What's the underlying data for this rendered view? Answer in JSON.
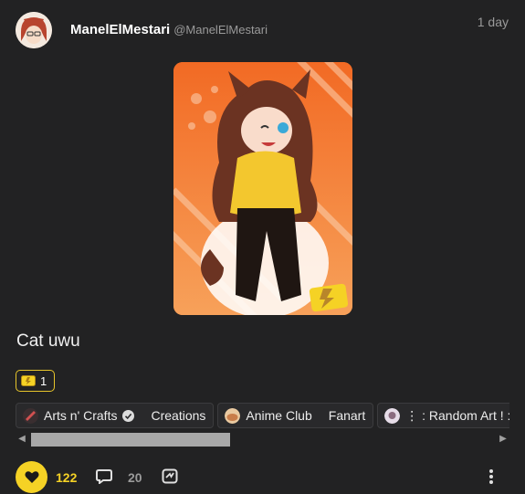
{
  "post": {
    "author_name": "ManelElMestari",
    "author_handle": "@ManelElMestari",
    "timestamp": "1 day",
    "title": "Cat uwu"
  },
  "badge": {
    "icon": "ticket-icon",
    "count": "1"
  },
  "chips": [
    {
      "community": "Arts n' Crafts",
      "verified": true,
      "category": "Creations"
    },
    {
      "community": "Anime Club",
      "category": "Fanart"
    },
    {
      "community": "⋮ : Random Art ! : .∙∿·"
    }
  ],
  "scrollbar": {
    "left_arrow": "◀",
    "right_arrow": "▶"
  },
  "actions": {
    "likes": "122",
    "comments": "20"
  },
  "colors": {
    "accent": "#f5d225",
    "background": "#222223",
    "artwork_bg": "#f07a2a"
  }
}
